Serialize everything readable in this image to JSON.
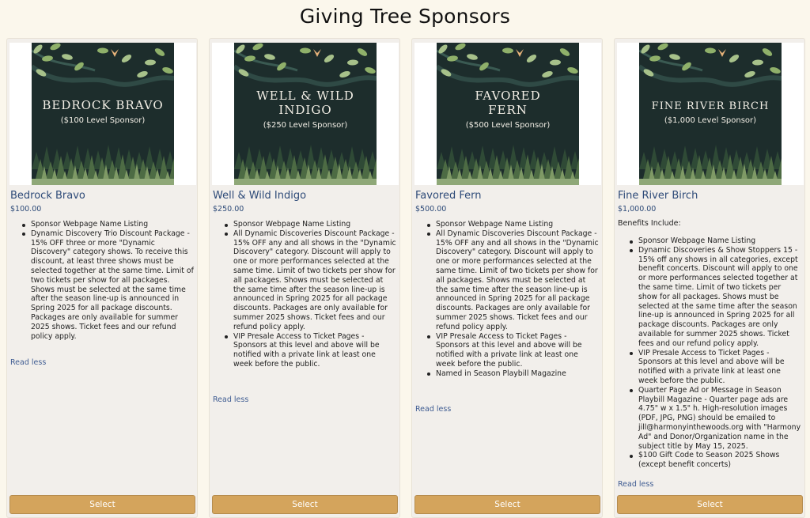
{
  "page": {
    "title": "Giving Tree Sponsors"
  },
  "colors": {
    "art_bg": "#1d2d2c",
    "button": "#d4a45c",
    "link": "#3f5c92"
  },
  "cards": [
    {
      "art_line1": "BEDROCK BRAVO",
      "art_line2": "",
      "art_sub": "($100 Level Sponsor)",
      "name": "Bedrock Bravo",
      "price": "$100.00",
      "intro": "",
      "benefits": [
        "Sponsor Webpage Name Listing",
        "Dynamic Discovery Trio Discount Package - 15% OFF three or more \"Dynamic Discovery\" category shows. To receive this discount, at least three shows must be selected together at the same time. Limit of two tickets per show for all packages. Shows must be selected at the same time after the season line-up is announced in Spring 2025 for all package discounts. Packages are only available for summer 2025 shows. Ticket fees and our refund policy apply."
      ],
      "read_less": "Read less",
      "select": "Select"
    },
    {
      "art_line1": "WELL & WILD",
      "art_line2": "INDIGO",
      "art_sub": "($250 Level Sponsor)",
      "name": "Well & Wild Indigo",
      "price": "$250.00",
      "intro": "",
      "benefits": [
        "Sponsor Webpage Name Listing",
        "All Dynamic Discoveries Discount Package - 15% OFF any and all shows in the \"Dynamic Discovery\" category. Discount will apply to one or more performances selected at the same time. Limit of two tickets per show for all packages. Shows must be selected at the same time after the season line-up is announced in Spring 2025 for all package discounts. Packages are only available for summer 2025 shows. Ticket fees and our refund policy apply.",
        "VIP Presale Access to Ticket Pages - Sponsors at this level and above will be notified with a private link at least one week before the public."
      ],
      "read_less": "Read less",
      "select": "Select"
    },
    {
      "art_line1": "FAVORED",
      "art_line2": "FERN",
      "art_sub": "($500 Level Sponsor)",
      "name": "Favored Fern",
      "price": "$500.00",
      "intro": "",
      "benefits": [
        "Sponsor Webpage Name Listing",
        "All Dynamic Discoveries Discount Package - 15% OFF any and all shows in the \"Dynamic Discovery\" category. Discount will apply to one or more performances selected at the same time. Limit of two tickets per show for all packages. Shows must be selected at the same time after the season line-up is announced in Spring 2025 for all package discounts. Packages are only available for summer 2025 shows. Ticket fees and our refund policy apply.",
        "VIP Presale Access to Ticket Pages - Sponsors at this level and above will be notified with a private link at least one week before the public.",
        "Named in Season Playbill Magazine"
      ],
      "read_less": "Read less",
      "select": "Select"
    },
    {
      "art_line1": "FINE RIVER BIRCH",
      "art_line2": "",
      "art_sub": "($1,000 Level Sponsor)",
      "name": "Fine River Birch",
      "price": "$1,000.00",
      "intro": "Benefits Include:",
      "benefits": [
        "Sponsor Webpage Name Listing",
        "Dynamic Discoveries & Show Stoppers 15 - 15% off any shows in all categories, except benefit concerts. Discount will apply to one or more performances selected together at the same time. Limit of two tickets per show for all packages. Shows must be selected at the same time after the season line-up is announced in Spring 2025 for all package discounts. Packages are only available for summer 2025 shows. Ticket fees and our refund policy apply.",
        "VIP Presale Access to Ticket Pages - Sponsors at this level and above will be notified with a private link at least one week before the public.",
        "Quarter Page Ad or Message in Season Playbill Magazine - Quarter page ads are 4.75\" w x 1.5\" h. High-resolution images (PDF, JPG, PNG) should be emailed to jill@harmonyinthewoods.org with \"Harmony Ad\" and Donor/Organization name in the subject title by May 15, 2025.",
        "$100 Gift Code to Season 2025 Shows (except benefit concerts)"
      ],
      "read_less": "Read less",
      "select": "Select"
    }
  ]
}
